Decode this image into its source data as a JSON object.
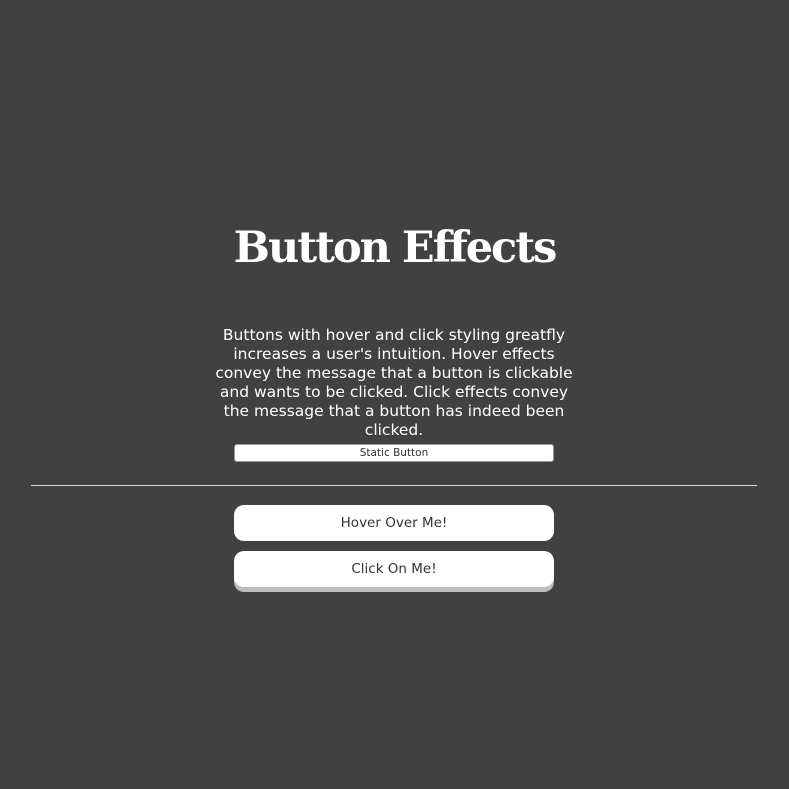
{
  "page": {
    "title": "Button Effects",
    "description": "Buttons with hover and click styling greatfly increases a user's intuition. Hover effects convey the message that a button is clickable and wants to be clicked. Click effects convey the message that a button has indeed been clicked."
  },
  "buttons": {
    "static_label": "Static Button",
    "hover_label": "Hover Over Me!",
    "click_label": "Click On Me!"
  },
  "colors": {
    "background": "#414141",
    "text": "#ffffff",
    "button_background": "#ffffff",
    "button_text": "#333333",
    "click_button_shadow": "#bdbdbd",
    "divider": "#d8d8d8"
  }
}
